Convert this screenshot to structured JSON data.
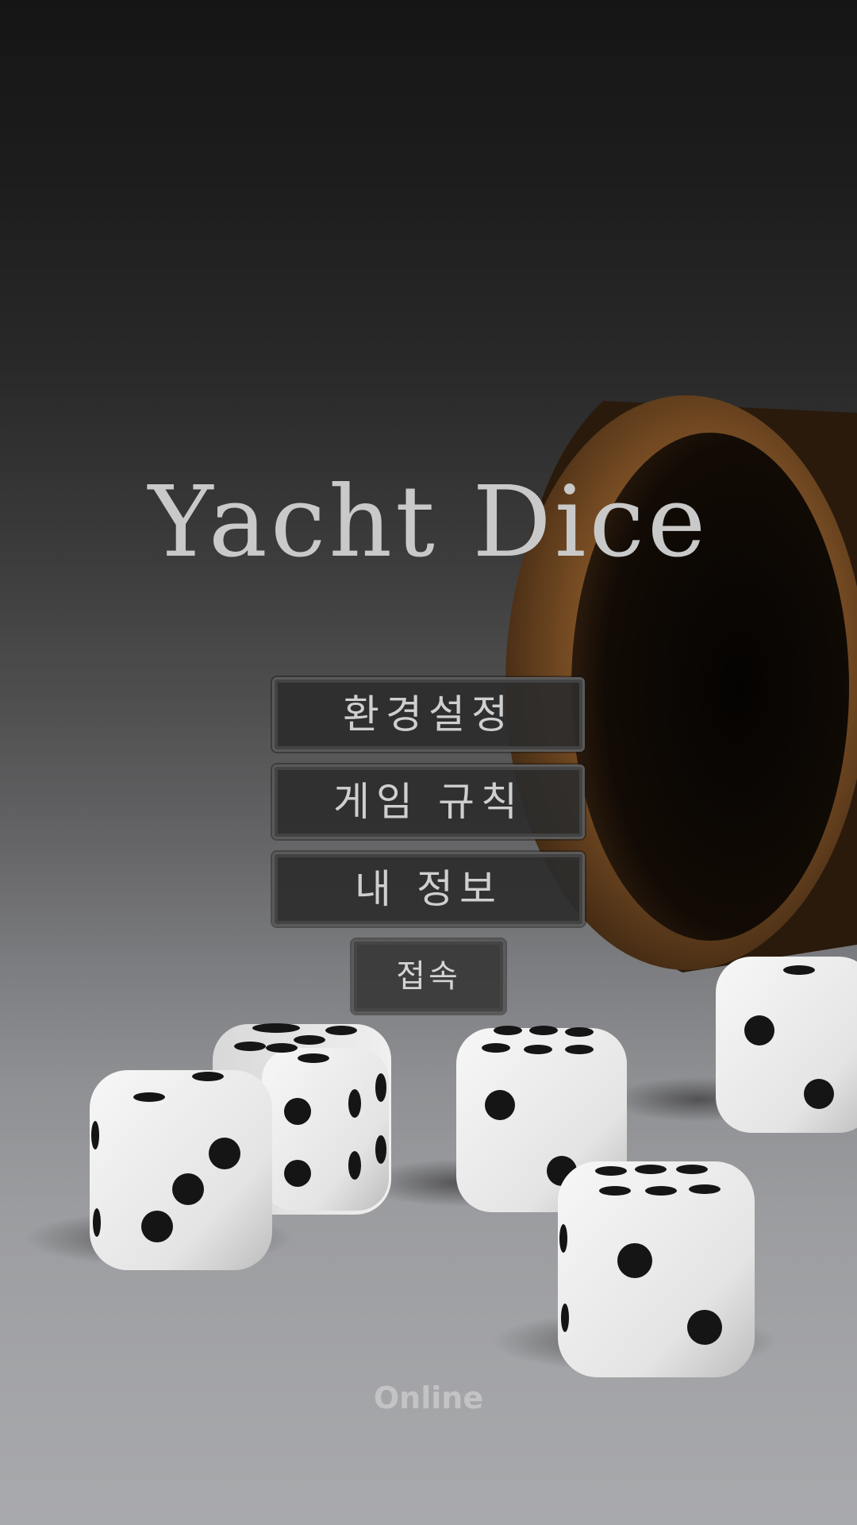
{
  "game": {
    "title": "Yacht Dice",
    "menu": {
      "settings_label": "환경설정",
      "rules_label": "게임 규칙",
      "myinfo_label": "내 정보",
      "connect_label": "접속"
    },
    "status": "Online"
  },
  "scene": {
    "background_image": "dice-and-cup-photo",
    "dice_faces_visible": [
      6,
      2,
      3,
      6,
      2,
      6,
      2,
      6,
      2
    ],
    "colors": {
      "title_text": "#c9c9c9",
      "button_bg": "#2c2c2c",
      "button_border": "#5a5a5a",
      "button_text": "#cfcfcf",
      "status_text": "#c3c3c5",
      "cup": "#8b5a2b",
      "dice": "#f2f2f2",
      "pips": "#151515"
    }
  }
}
